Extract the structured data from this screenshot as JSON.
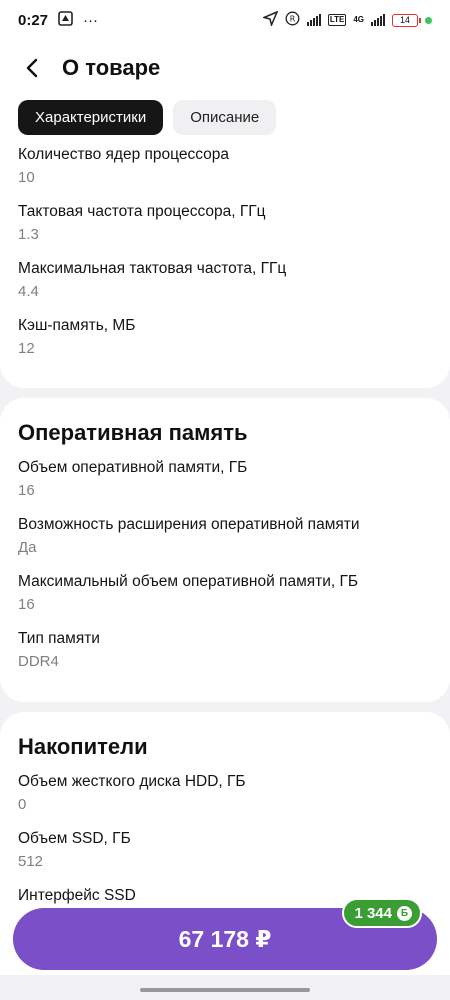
{
  "status_bar": {
    "time": "0:27",
    "dots": "···",
    "battery": "14",
    "network": "4G",
    "r_badge": "R",
    "lte_badge": "LTE"
  },
  "header": {
    "title": "О товаре"
  },
  "tabs": [
    {
      "label": "Характеристики",
      "active": true
    },
    {
      "label": "Описание",
      "active": false
    }
  ],
  "processor_specs": [
    {
      "label": "Количество ядер процессора",
      "value": "10"
    },
    {
      "label": "Тактовая частота процессора, ГГц",
      "value": "1.3"
    },
    {
      "label": "Максимальная тактовая частота, ГГц",
      "value": "4.4"
    },
    {
      "label": "Кэш-память, МБ",
      "value": "12"
    }
  ],
  "ram_section": {
    "title": "Оперативная память",
    "specs": [
      {
        "label": "Объем оперативной памяти, ГБ",
        "value": "16"
      },
      {
        "label": "Возможность расширения оперативной памяти",
        "value": "Да"
      },
      {
        "label": "Максимальный объем оперативной памяти, ГБ",
        "value": "16"
      },
      {
        "label": "Тип памяти",
        "value": "DDR4"
      }
    ]
  },
  "storage_section": {
    "title": "Накопители",
    "specs": [
      {
        "label": "Объем жесткого диска HDD, ГБ",
        "value": "0"
      },
      {
        "label": "Объем SSD, ГБ",
        "value": "512"
      },
      {
        "label": "Интерфейс SSD",
        "value": ""
      }
    ]
  },
  "buy": {
    "price": "67 178 ₽",
    "bonus": "1 344",
    "bonus_symbol": "Б"
  },
  "colors": {
    "accent": "#7b4fc8",
    "bonus_green": "#3a9e35",
    "tab_active": "#161616"
  }
}
